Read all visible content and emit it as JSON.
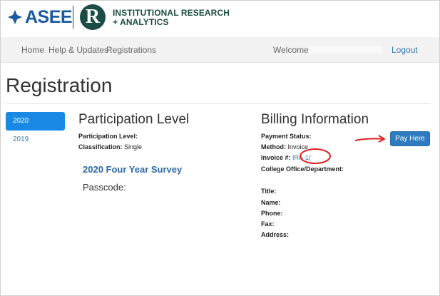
{
  "logos": {
    "asee_text": "ASEE",
    "r_mark": "R",
    "ira_line1": "INSTITUTIONAL RESEARCH",
    "ira_line2": "+ ANALYTICS"
  },
  "nav": {
    "items": [
      "Home",
      "Help & Updates",
      "Registrations"
    ],
    "welcome": "Welcome",
    "logout": "Logout"
  },
  "page_title": "Registration",
  "years": [
    "2020",
    "2019"
  ],
  "participation": {
    "heading": "Participation Level",
    "level_label": "Participation Level:",
    "classification_label": "Classification:",
    "classification_value": "Single",
    "survey_title": "2020 Four Year Survey",
    "passcode_label": "Passcode:"
  },
  "billing": {
    "heading": "Billing Information",
    "payment_status_label": "Payment Status:",
    "method_label": "Method:",
    "method_value": "Invoice",
    "invoice_label": "Invoice #:",
    "invoice_value": "IRA-1(",
    "office_label": "College Office/Department:",
    "title_label": "Title:",
    "name_label": "Name:",
    "phone_label": "Phone:",
    "fax_label": "Fax:",
    "address_label": "Address:",
    "pay_button": "Pay Here"
  },
  "colors": {
    "asee_blue": "#1a5a9e",
    "ira_green": "#1b4c45",
    "active_pill": "#1a89e6",
    "button_blue": "#2e7bbf",
    "link_blue": "#337ab7",
    "annotation_red": "#e02020"
  }
}
